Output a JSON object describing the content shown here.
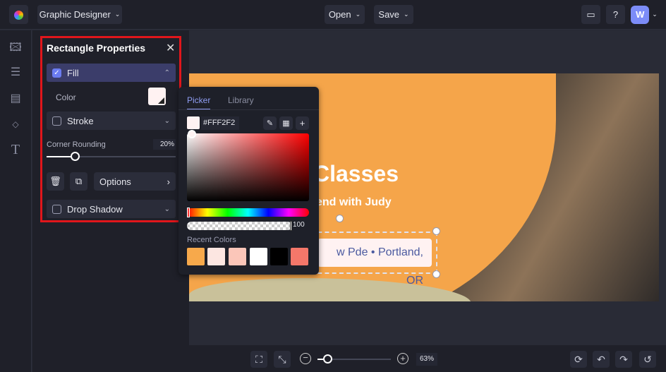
{
  "topbar": {
    "app_name": "Graphic Designer",
    "open_label": "Open",
    "save_label": "Save",
    "avatar_initial": "W"
  },
  "rail": {
    "items": [
      "image-icon",
      "adjustments-icon",
      "layout-icon",
      "shapes-icon",
      "text-icon"
    ]
  },
  "panel": {
    "title": "Rectangle Properties",
    "fill_label": "Fill",
    "color_label": "Color",
    "stroke_label": "Stroke",
    "corner_rounding_label": "Corner Rounding",
    "corner_rounding_value": "20%",
    "corner_rounding_fraction": 0.2,
    "options_label": "Options",
    "drop_shadow_label": "Drop Shadow",
    "fill_color": "#FFF2F2"
  },
  "picker": {
    "tab_picker": "Picker",
    "tab_library": "Library",
    "hex_value": "#FFF2F2",
    "opacity_value": "100",
    "recent_label": "Recent Colors",
    "recent_colors": [
      "#F7A94B",
      "#FCE6E1",
      "#FBC6B9",
      "#FFFFFF",
      "#000000",
      "#F4776A"
    ]
  },
  "canvas": {
    "heading": "Classes",
    "subheading": "end with Judy",
    "address": "w Pde • Portland, OR"
  },
  "bottombar": {
    "zoom_value": "63%",
    "zoom_fraction": 0.1
  }
}
